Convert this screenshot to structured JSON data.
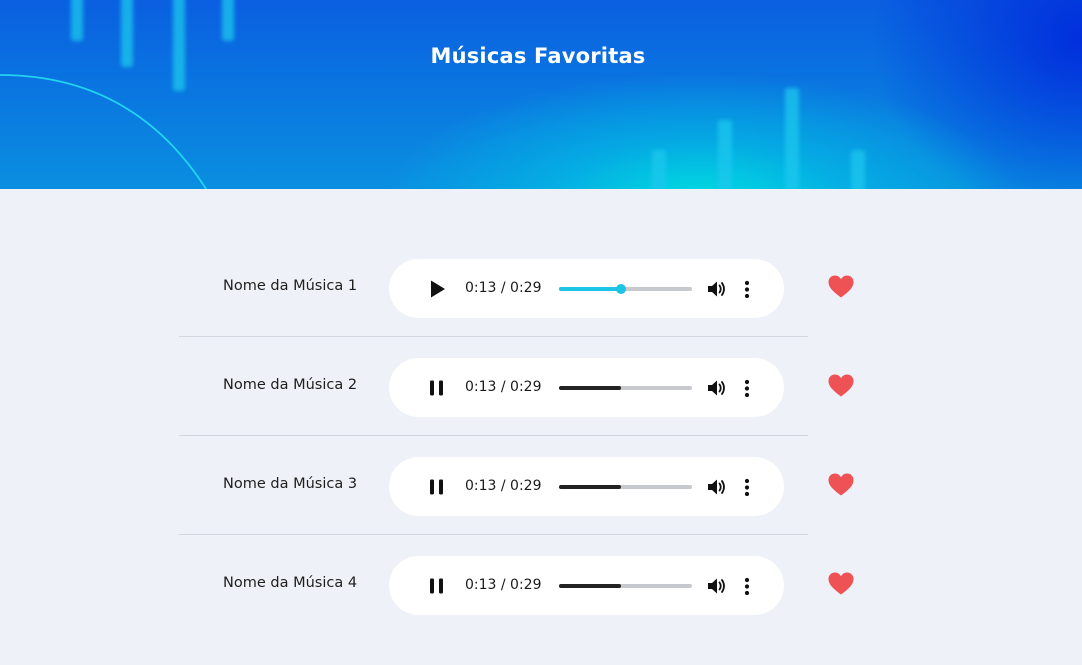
{
  "header": {
    "title": "Músicas Favoritas"
  },
  "colors": {
    "accent": "#1cc4e6",
    "heart": "#ee5255",
    "page_background": "#eef1f8",
    "banner_blue": "#0a5fe0"
  },
  "tracks": [
    {
      "name": "Nome da Música 1",
      "time": "0:13 / 0:29",
      "state": "paused",
      "button_icon": "play-icon",
      "progress": 0.466,
      "active": true,
      "favorite": true
    },
    {
      "name": "Nome da Música 2",
      "time": "0:13 / 0:29",
      "state": "playing",
      "button_icon": "pause-icon",
      "progress": 0.466,
      "active": false,
      "favorite": true
    },
    {
      "name": "Nome da Música 3",
      "time": "0:13 / 0:29",
      "state": "playing",
      "button_icon": "pause-icon",
      "progress": 0.466,
      "active": false,
      "favorite": true
    },
    {
      "name": "Nome da Música 4",
      "time": "0:13 / 0:29",
      "state": "playing",
      "button_icon": "pause-icon",
      "progress": 0.466,
      "active": false,
      "favorite": true
    }
  ],
  "icons": {
    "volume": "volume-icon",
    "more": "more-vertical-icon",
    "favorite": "heart-icon"
  }
}
